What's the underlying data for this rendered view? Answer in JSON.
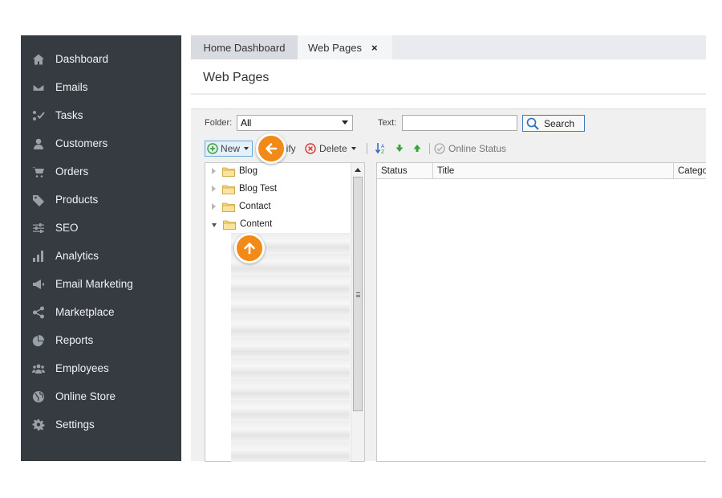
{
  "sidebar": {
    "items": [
      {
        "label": "Dashboard",
        "icon": "home-icon"
      },
      {
        "label": "Emails",
        "icon": "envelope-icon"
      },
      {
        "label": "Tasks",
        "icon": "tasks-icon"
      },
      {
        "label": "Customers",
        "icon": "user-icon"
      },
      {
        "label": "Orders",
        "icon": "cart-icon"
      },
      {
        "label": "Products",
        "icon": "tag-icon"
      },
      {
        "label": "SEO",
        "icon": "sliders-icon"
      },
      {
        "label": "Analytics",
        "icon": "bar-chart-icon"
      },
      {
        "label": "Email Marketing",
        "icon": "megaphone-icon"
      },
      {
        "label": "Marketplace",
        "icon": "share-icon"
      },
      {
        "label": "Reports",
        "icon": "pie-chart-icon"
      },
      {
        "label": "Employees",
        "icon": "group-icon"
      },
      {
        "label": "Online Store",
        "icon": "globe-icon"
      },
      {
        "label": "Settings",
        "icon": "gear-icon"
      }
    ]
  },
  "tabs": {
    "home": "Home Dashboard",
    "web": "Web Pages",
    "close": "×"
  },
  "page": {
    "title": "Web Pages"
  },
  "filter": {
    "folder_label": "Folder:",
    "folder_value": "All",
    "text_label": "Text:",
    "text_value": "",
    "search_label": "Search"
  },
  "toolbar": {
    "new_label": "New",
    "modify_label": "lify",
    "delete_label": "Delete",
    "online_status_label": "Online Status"
  },
  "tree": {
    "nodes": [
      {
        "label": "Blog",
        "expanded": false
      },
      {
        "label": "Blog Test",
        "expanded": false
      },
      {
        "label": "Contact",
        "expanded": false
      },
      {
        "label": "Content",
        "expanded": true
      }
    ]
  },
  "grid": {
    "columns": [
      "Status",
      "Title",
      "Catego"
    ]
  },
  "colors": {
    "sidebar_bg": "#363b42",
    "accent": "#3a7bbf",
    "hint_badge": "#f28a1a"
  }
}
